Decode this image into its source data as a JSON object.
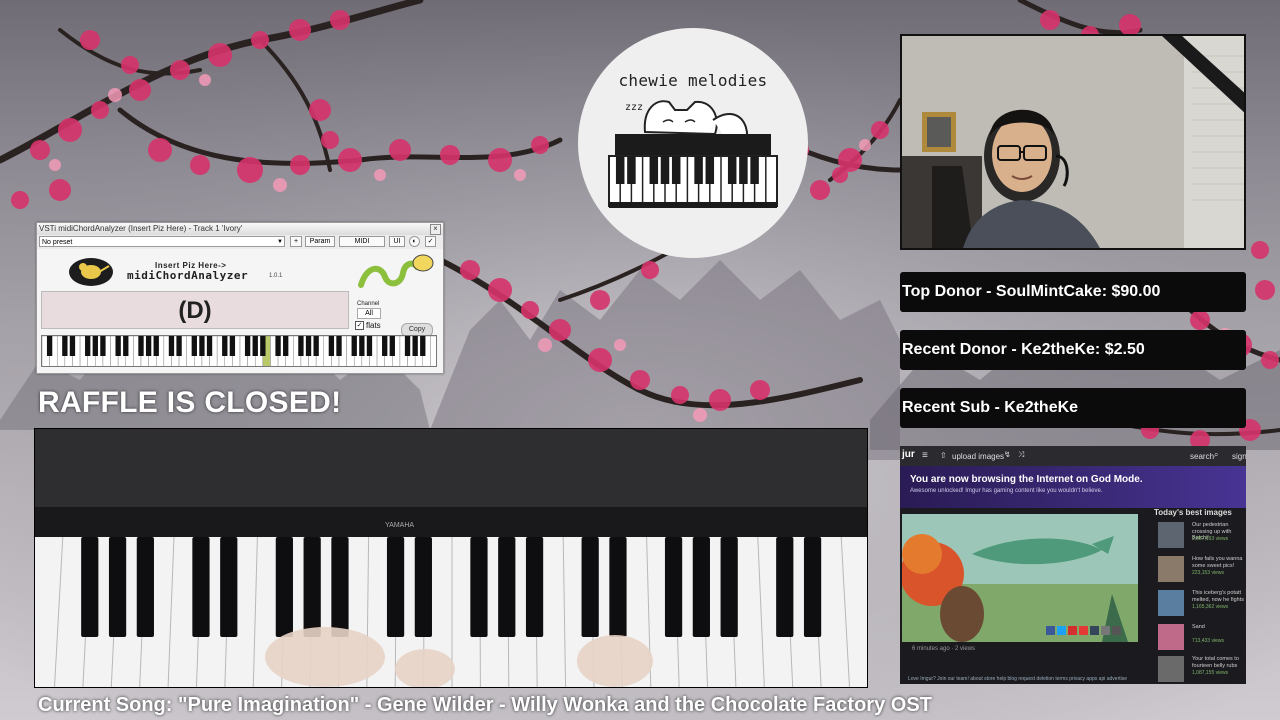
{
  "plugin": {
    "title": "VSTi midiChordAnalyzer (Insert Piz Here) - Track 1 'Ivory'",
    "preset": "No preset",
    "plus_button": "+",
    "param_button": "Param",
    "midi_button": "MIDI",
    "ui_button": "UI",
    "header_small": "Insert Piz Here->",
    "header_big": "midiChordAnalyzer",
    "version": "1.0.1",
    "chord": "(D)",
    "channel_label": "Channel",
    "channel_value": "All",
    "flats_label": "flats",
    "copy_button": "Copy"
  },
  "logo": {
    "title": "chewie melodies",
    "zzz": "zzz"
  },
  "info": {
    "top_donor": "Top Donor -  SoulMintCake: $90.00",
    "recent_donor": "Recent Donor - Ke2theKe: $2.50",
    "recent_sub": "Recent Sub -  Ke2theKe"
  },
  "raffle": "RAFFLE IS CLOSED!",
  "keyboard_brand": "YAMAHA",
  "imgur": {
    "logo": "jur",
    "upload": "upload images",
    "search": "search",
    "sign": "sign",
    "banner_title": "You are now browsing the Internet on God Mode.",
    "banner_sub": "Awesome unlocked! Imgur has gaming content like you wouldn't believe.",
    "side_title": "Today's best images",
    "side_items": [
      {
        "text": "Our pedestrian crossing up with Batchi!",
        "sub": "2,887,193 views"
      },
      {
        "text": "How fails you wanna some sweet pics!",
        "sub": "223,153 views"
      },
      {
        "text": "This iceberg's potatt melted, now he fights",
        "sub": "1,165,362 views"
      },
      {
        "text": "Sand",
        "sub": "713,433 views"
      },
      {
        "text": "Your total comes to fourteen belly rubs",
        "sub": "1,087,155 views"
      }
    ],
    "meta": "6 minutes ago · 2 views",
    "footer": "Love Imgur? Join our team!   about   store   help   blog   request deletion   terms   privacy   apps   api   advertise"
  },
  "current_song": "Current Song: \"Pure Imagination\" - Gene Wilder - Willy Wonka and the Chocolate Factory OST"
}
